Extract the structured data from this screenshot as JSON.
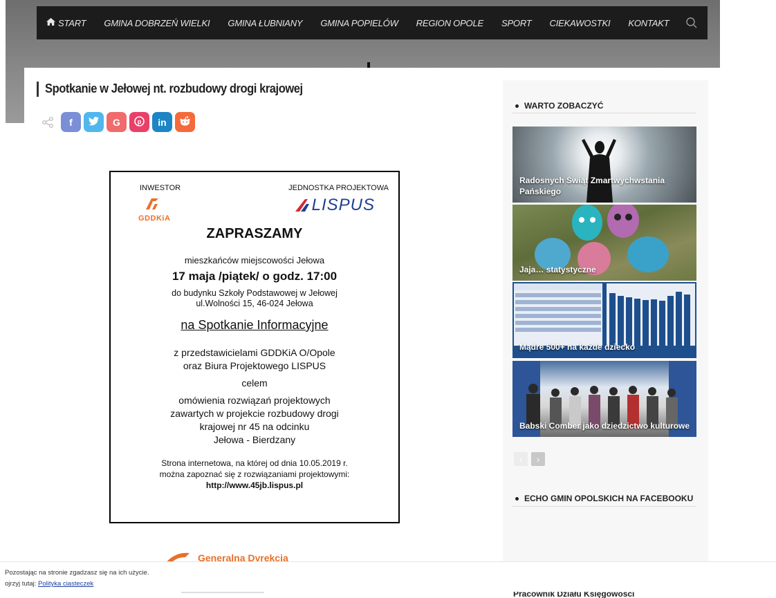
{
  "nav": {
    "items": [
      "START",
      "GMINA DOBRZEŃ WIELKI",
      "GMINA ŁUBNIANY",
      "GMINA POPIELÓW",
      "REGION OPOLE",
      "SPORT",
      "CIEKAWOSTKI",
      "KONTAKT"
    ],
    "home_icon": "home-icon",
    "search_icon": "search-icon"
  },
  "post": {
    "title": "Spotkanie w Jełowej nt. rozbudowy drogi krajowej",
    "share_buttons": [
      {
        "name": "facebook-share-button",
        "glyph": "f",
        "icon": "facebook-icon"
      },
      {
        "name": "twitter-share-button",
        "glyph": "t",
        "icon": "twitter-icon"
      },
      {
        "name": "google-share-button",
        "glyph": "G",
        "icon": "google-icon"
      },
      {
        "name": "pinterest-share-button",
        "glyph": "p",
        "icon": "pinterest-icon"
      },
      {
        "name": "linkedin-share-button",
        "glyph": "in",
        "icon": "linkedin-icon"
      },
      {
        "name": "reddit-share-button",
        "glyph": "r",
        "icon": "reddit-icon"
      }
    ]
  },
  "poster": {
    "investor_label": "INWESTOR",
    "unit_label": "JEDNOSTKA PROJEKTOWA",
    "gddkia_logo_text": "GDDKiA",
    "lispus_logo_text": "LISPUS",
    "heading": "ZAPRASZAMY",
    "lines": [
      "mieszkańców miejscowości Jełowa",
      "17 maja /piątek/ o godz. 17:00",
      "do budynku Szkoły Podstawowej w Jełowej",
      "ul.Wolności 15, 46-024 Jełowa",
      "na Spotkanie Informacyjne",
      "z przedstawicielami GDDKiA O/Opole",
      "oraz Biura Projektowego LISPUS",
      "celem",
      "omówienia rozwiązań projektowych",
      "zawartych w projekcie rozbudowy drogi",
      "krajowej nr 45 na odcinku",
      "Jełowa - Bierdzany",
      "Strona internetowa, na której od dnia 10.05.2019 r.",
      "można zapoznać się z rozwiązaniami projektowymi:",
      "http://www.45jb.lispus.pl"
    ]
  },
  "lower_logo_text": "Generalna Dyrekcja",
  "sidebar": {
    "widget1_title": "WARTO ZOBACZYĆ",
    "widget2_title": "ECHO GMIN OPOLSKICH NA FACEBOOKU",
    "items": [
      {
        "caption": "Radosnych Świąt Zmartwychwstania Pańskiego"
      },
      {
        "caption": "Jaja… statystyczne"
      },
      {
        "caption": "Mądre 500+ na każde dziecko"
      },
      {
        "caption": "Babski Comber jako dziedzictwo kulturowe"
      }
    ],
    "prev_icon": "chevron-left-icon",
    "next_icon": "chevron-right-icon",
    "cut_text": "Pracownik Działu Księgowości"
  },
  "cookie": {
    "line1": "Pozostając na stronie zgadzasz się na ich użycie.",
    "line2_prefix": "ojrzyj tutaj:",
    "link": "Polityka ciasteczek"
  },
  "colors": {
    "nav_bg": "#1c1c1c",
    "accent_orange": "#e8702a",
    "lispus_blue": "#1f3f8f"
  }
}
